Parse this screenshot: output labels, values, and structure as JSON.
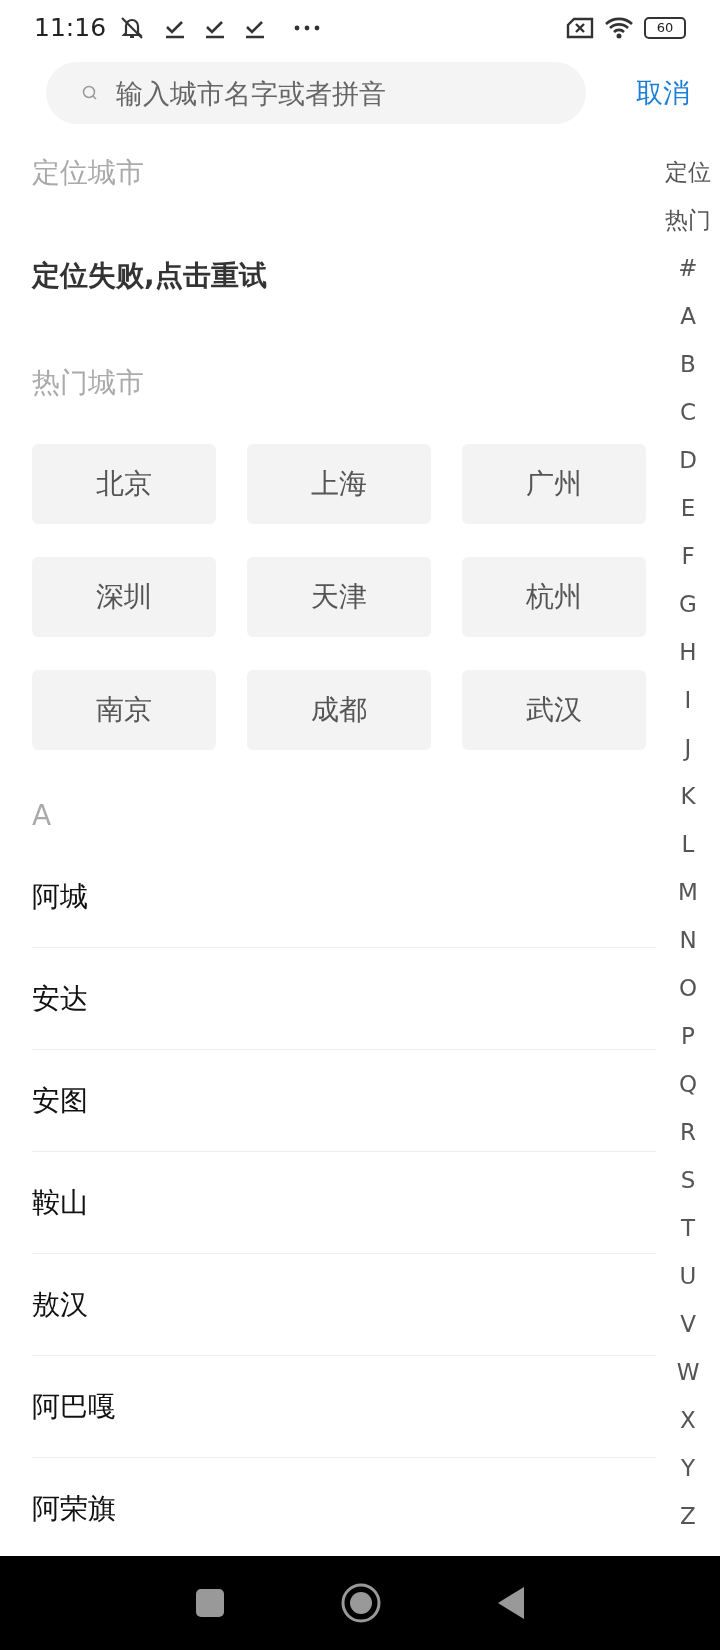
{
  "status_bar": {
    "time": "11:16",
    "battery": "60"
  },
  "search": {
    "placeholder": "输入城市名字或者拼音",
    "cancel": "取消"
  },
  "location_section": {
    "title": "定位城市",
    "message": "定位失败,点击重试"
  },
  "hot_section": {
    "title": "热门城市",
    "cities": [
      "北京",
      "上海",
      "广州",
      "深圳",
      "天津",
      "杭州",
      "南京",
      "成都",
      "武汉"
    ]
  },
  "city_groups": [
    {
      "letter": "A",
      "cities": [
        "阿城",
        "安达",
        "安图",
        "鞍山",
        "敖汉",
        "阿巴嘎",
        "阿荣旗"
      ]
    }
  ],
  "index_bar": [
    "定位",
    "热门",
    "#",
    "A",
    "B",
    "C",
    "D",
    "E",
    "F",
    "G",
    "H",
    "I",
    "J",
    "K",
    "L",
    "M",
    "N",
    "O",
    "P",
    "Q",
    "R",
    "S",
    "T",
    "U",
    "V",
    "W",
    "X",
    "Y",
    "Z"
  ]
}
